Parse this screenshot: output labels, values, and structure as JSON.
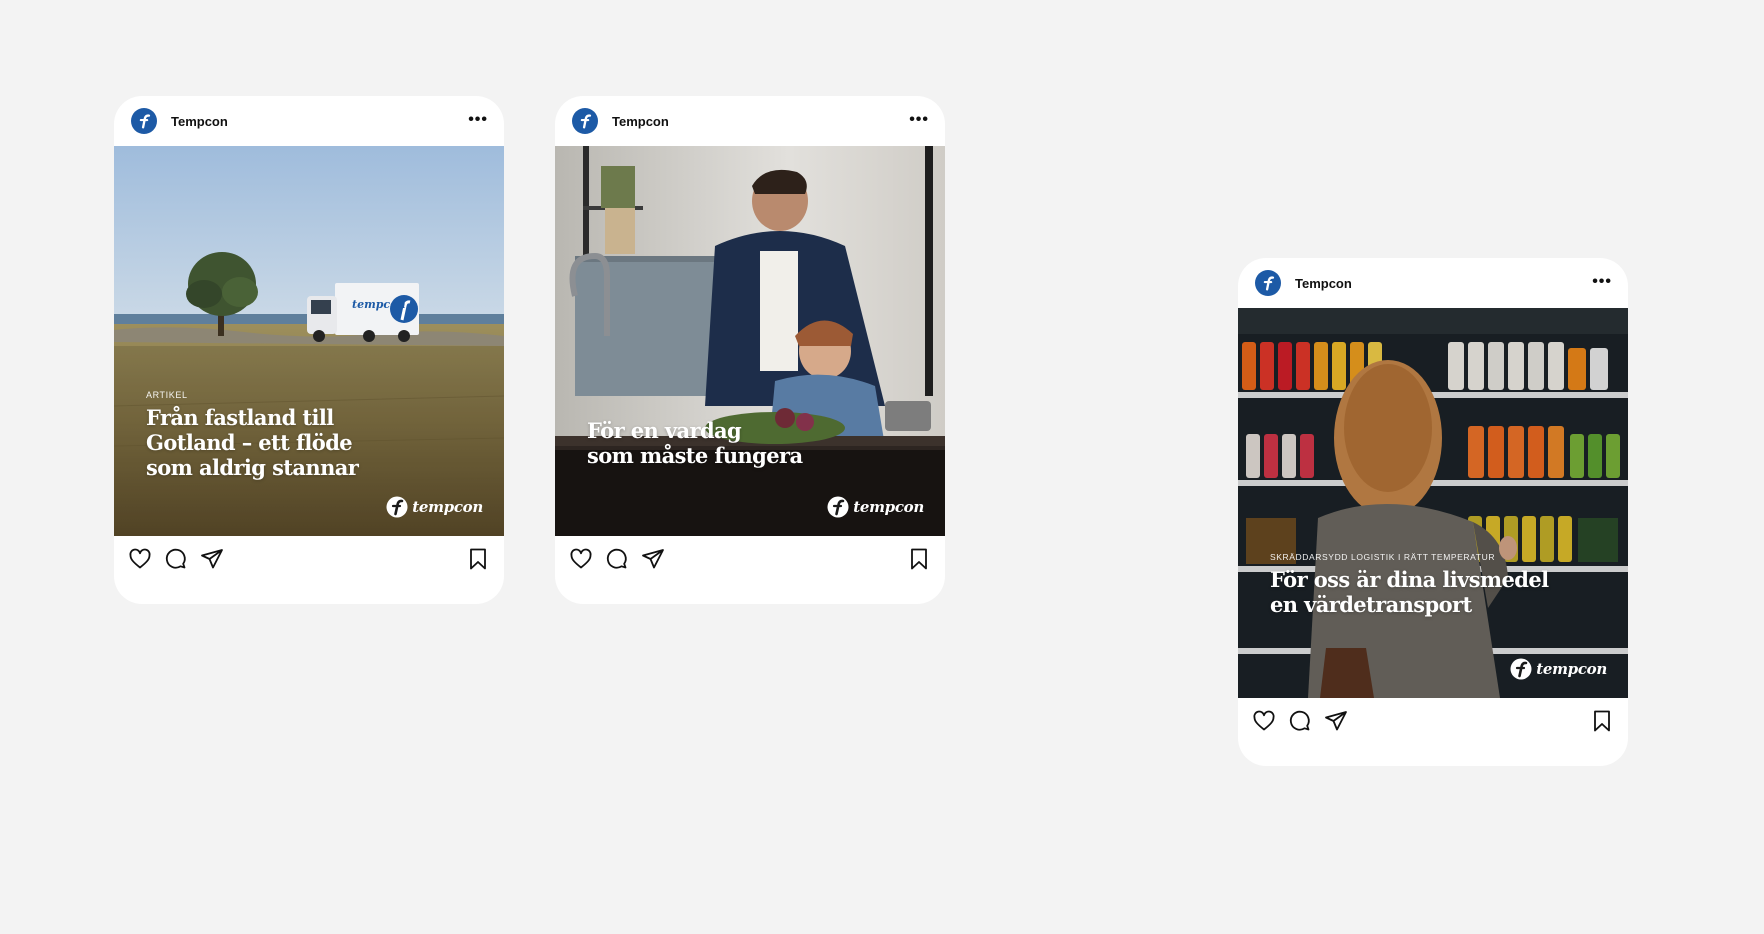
{
  "posts": [
    {
      "account": "Tempcon",
      "eyebrow": "ARTIKEL",
      "headline": "Från fastland till\nGotland – ett flöde\nsom aldrig stannar",
      "brand": "tempcon"
    },
    {
      "account": "Tempcon",
      "eyebrow": "",
      "headline": "För en vardag\nsom måste fungera",
      "brand": "tempcon"
    },
    {
      "account": "Tempcon",
      "eyebrow": "SKRÄDDARSYDD LOGISTIK I RÄTT TEMPERATUR",
      "headline": "För oss är dina livsmedel\nen värdetransport",
      "brand": "tempcon"
    }
  ],
  "truck_branding": "tempcon",
  "icons": {
    "like": "heart-icon",
    "comment": "comment-icon",
    "share": "share-icon",
    "save": "bookmark-icon",
    "more": "more-icon",
    "logo": "tempcon-logo-icon"
  },
  "colors": {
    "background": "#f3f3f3",
    "card": "#ffffff",
    "brand_blue": "#1d5aa6"
  }
}
